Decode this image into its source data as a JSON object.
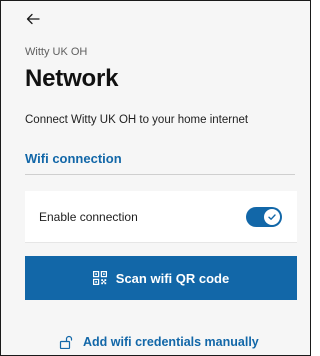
{
  "header": {
    "back_icon": "arrow-left-icon",
    "device_name": "Witty UK OH",
    "title": "Network"
  },
  "main": {
    "description": "Connect Witty UK OH to your home internet",
    "section_title": "Wifi connection",
    "enable_connection": {
      "label": "Enable connection",
      "enabled": true
    },
    "scan_button": {
      "icon": "qr-code-icon",
      "label": "Scan wifi QR code"
    },
    "manual_link": {
      "icon": "lock-icon",
      "label": "Add wifi credentials manually"
    }
  },
  "colors": {
    "accent": "#1267a8",
    "background": "#f6f6f6",
    "card": "#ffffff"
  }
}
